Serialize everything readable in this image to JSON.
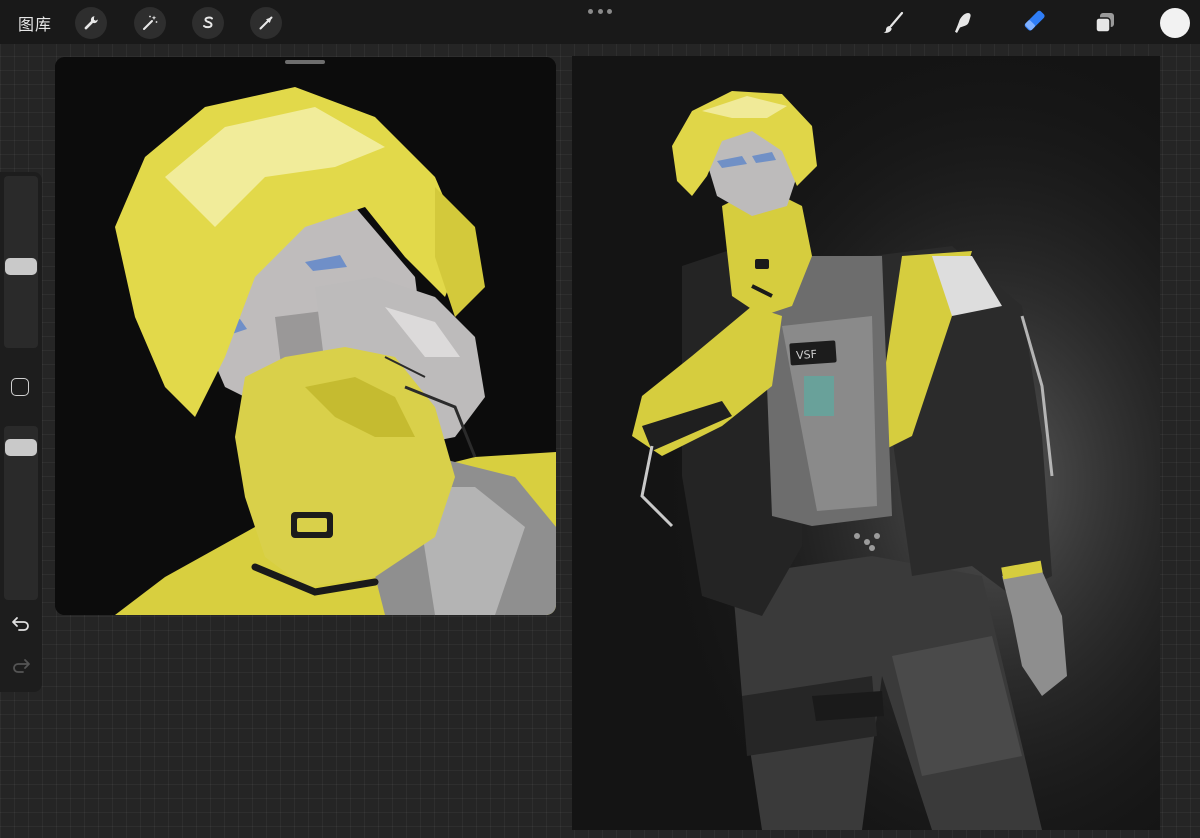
{
  "toolbar": {
    "gallery_label": "图库",
    "left_tools": [
      {
        "name": "actions",
        "icon": "wrench-icon"
      },
      {
        "name": "adjustments",
        "icon": "magic-wand-icon"
      },
      {
        "name": "selection",
        "icon": "selection-s-icon"
      },
      {
        "name": "transform",
        "icon": "arrow-cursor-icon"
      }
    ],
    "more_icon": "more-dots-icon",
    "right_tools": [
      {
        "name": "brush",
        "icon": "brush-icon",
        "active": false
      },
      {
        "name": "smudge",
        "icon": "smudge-finger-icon",
        "active": false
      },
      {
        "name": "eraser",
        "icon": "eraser-icon",
        "active": true
      },
      {
        "name": "layers",
        "icon": "layers-icon",
        "active": false
      }
    ],
    "active_color": "#f2f2f2",
    "active_tool_color": "#2f7df6"
  },
  "sidebar": {
    "brush_size_level": 0.47,
    "opacity_level": 0.92,
    "undo_icon": "undo-arrow-icon",
    "redo_icon": "redo-arrow-icon"
  },
  "reference": {
    "description_icon": "reference-image",
    "accent_color": "#e5dc4a"
  },
  "canvas": {
    "accent_color": "#e5dc4a"
  }
}
